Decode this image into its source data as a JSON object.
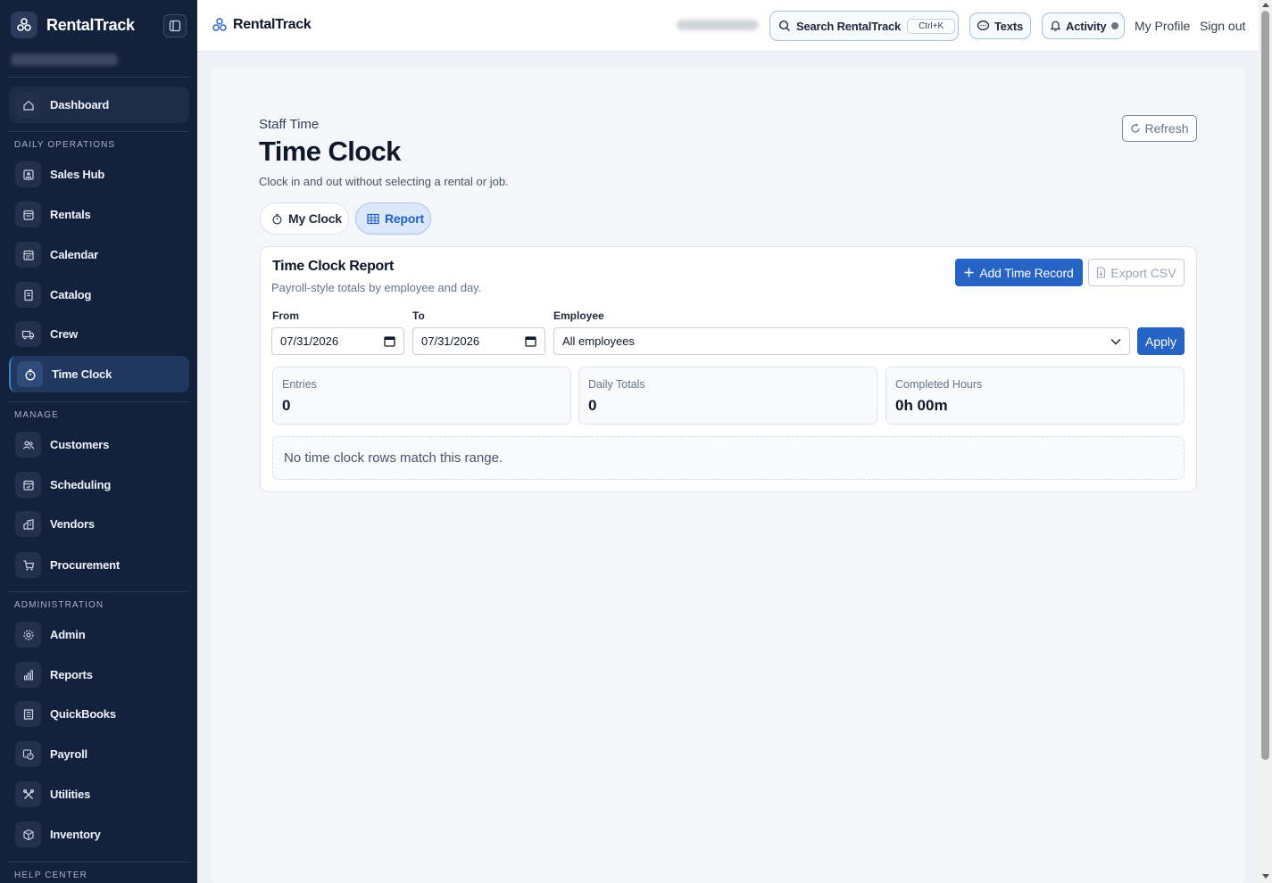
{
  "app": {
    "name": "RentalTrack"
  },
  "colors": {
    "sidebar_bg": "#14213d",
    "accent": "#2563c4",
    "active_nav": "#22375e"
  },
  "sidebar": {
    "dashboard": "Dashboard",
    "sections": {
      "daily": "DAILY OPERATIONS",
      "manage": "MANAGE",
      "admin": "ADMINISTRATION",
      "help": "HELP CENTER"
    },
    "daily_items": [
      {
        "label": "Sales Hub",
        "icon": "sales-hub-icon"
      },
      {
        "label": "Rentals",
        "icon": "rentals-icon"
      },
      {
        "label": "Calendar",
        "icon": "calendar-icon"
      },
      {
        "label": "Catalog",
        "icon": "catalog-icon"
      },
      {
        "label": "Crew",
        "icon": "truck-icon"
      },
      {
        "label": "Time Clock",
        "icon": "stopwatch-icon",
        "active": true
      }
    ],
    "manage_items": [
      {
        "label": "Customers",
        "icon": "users-icon"
      },
      {
        "label": "Scheduling",
        "icon": "schedule-icon"
      },
      {
        "label": "Vendors",
        "icon": "building-icon"
      },
      {
        "label": "Procurement",
        "icon": "cart-icon"
      }
    ],
    "admin_items": [
      {
        "label": "Admin",
        "icon": "gear-icon"
      },
      {
        "label": "Reports",
        "icon": "bar-chart-icon"
      },
      {
        "label": "QuickBooks",
        "icon": "ledger-icon"
      },
      {
        "label": "Payroll",
        "icon": "payroll-icon"
      },
      {
        "label": "Utilities",
        "icon": "tools-icon"
      },
      {
        "label": "Inventory",
        "icon": "box-icon"
      }
    ]
  },
  "header": {
    "brand": "RentalTrack",
    "search_label": "Search RentalTrack",
    "search_shortcut": "Ctrl+K",
    "texts_label": "Texts",
    "activity_label": "Activity",
    "profile_label": "My Profile",
    "signout_label": "Sign out"
  },
  "page": {
    "eyebrow": "Staff Time",
    "title": "Time Clock",
    "subtitle": "Clock in and out without selecting a rental or job.",
    "refresh_label": "Refresh",
    "tabs": {
      "my_clock": "My Clock",
      "report": "Report"
    }
  },
  "report": {
    "title": "Time Clock Report",
    "subtitle": "Payroll-style totals by employee and day.",
    "add_label": "Add Time Record",
    "export_label": "Export CSV",
    "from_label": "From",
    "from_value": "07/31/2026",
    "to_label": "To",
    "to_value": "07/31/2026",
    "employee_label": "Employee",
    "employee_value": "All employees",
    "apply_label": "Apply",
    "stats": {
      "entries_label": "Entries",
      "entries_value": "0",
      "daily_label": "Daily Totals",
      "daily_value": "0",
      "hours_label": "Completed Hours",
      "hours_value": "0h 00m"
    },
    "empty_message": "No time clock rows match this range."
  }
}
